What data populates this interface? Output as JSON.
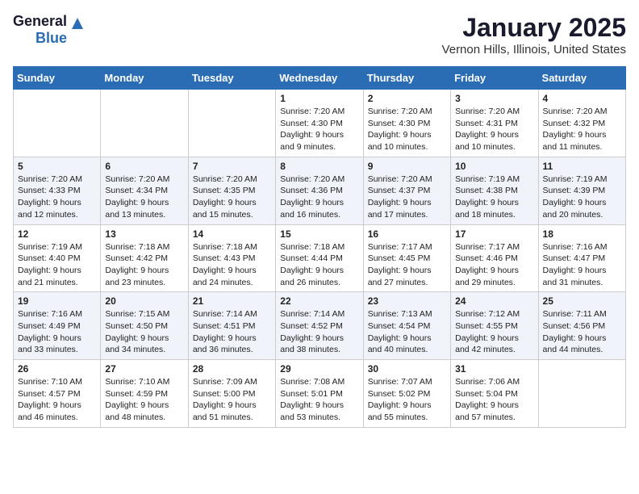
{
  "logo": {
    "general": "General",
    "blue": "Blue"
  },
  "title": "January 2025",
  "subtitle": "Vernon Hills, Illinois, United States",
  "days_of_week": [
    "Sunday",
    "Monday",
    "Tuesday",
    "Wednesday",
    "Thursday",
    "Friday",
    "Saturday"
  ],
  "weeks": [
    [
      {
        "day": "",
        "content": ""
      },
      {
        "day": "",
        "content": ""
      },
      {
        "day": "",
        "content": ""
      },
      {
        "day": "1",
        "content": "Sunrise: 7:20 AM\nSunset: 4:30 PM\nDaylight: 9 hours and 9 minutes."
      },
      {
        "day": "2",
        "content": "Sunrise: 7:20 AM\nSunset: 4:30 PM\nDaylight: 9 hours and 10 minutes."
      },
      {
        "day": "3",
        "content": "Sunrise: 7:20 AM\nSunset: 4:31 PM\nDaylight: 9 hours and 10 minutes."
      },
      {
        "day": "4",
        "content": "Sunrise: 7:20 AM\nSunset: 4:32 PM\nDaylight: 9 hours and 11 minutes."
      }
    ],
    [
      {
        "day": "5",
        "content": "Sunrise: 7:20 AM\nSunset: 4:33 PM\nDaylight: 9 hours and 12 minutes."
      },
      {
        "day": "6",
        "content": "Sunrise: 7:20 AM\nSunset: 4:34 PM\nDaylight: 9 hours and 13 minutes."
      },
      {
        "day": "7",
        "content": "Sunrise: 7:20 AM\nSunset: 4:35 PM\nDaylight: 9 hours and 15 minutes."
      },
      {
        "day": "8",
        "content": "Sunrise: 7:20 AM\nSunset: 4:36 PM\nDaylight: 9 hours and 16 minutes."
      },
      {
        "day": "9",
        "content": "Sunrise: 7:20 AM\nSunset: 4:37 PM\nDaylight: 9 hours and 17 minutes."
      },
      {
        "day": "10",
        "content": "Sunrise: 7:19 AM\nSunset: 4:38 PM\nDaylight: 9 hours and 18 minutes."
      },
      {
        "day": "11",
        "content": "Sunrise: 7:19 AM\nSunset: 4:39 PM\nDaylight: 9 hours and 20 minutes."
      }
    ],
    [
      {
        "day": "12",
        "content": "Sunrise: 7:19 AM\nSunset: 4:40 PM\nDaylight: 9 hours and 21 minutes."
      },
      {
        "day": "13",
        "content": "Sunrise: 7:18 AM\nSunset: 4:42 PM\nDaylight: 9 hours and 23 minutes."
      },
      {
        "day": "14",
        "content": "Sunrise: 7:18 AM\nSunset: 4:43 PM\nDaylight: 9 hours and 24 minutes."
      },
      {
        "day": "15",
        "content": "Sunrise: 7:18 AM\nSunset: 4:44 PM\nDaylight: 9 hours and 26 minutes."
      },
      {
        "day": "16",
        "content": "Sunrise: 7:17 AM\nSunset: 4:45 PM\nDaylight: 9 hours and 27 minutes."
      },
      {
        "day": "17",
        "content": "Sunrise: 7:17 AM\nSunset: 4:46 PM\nDaylight: 9 hours and 29 minutes."
      },
      {
        "day": "18",
        "content": "Sunrise: 7:16 AM\nSunset: 4:47 PM\nDaylight: 9 hours and 31 minutes."
      }
    ],
    [
      {
        "day": "19",
        "content": "Sunrise: 7:16 AM\nSunset: 4:49 PM\nDaylight: 9 hours and 33 minutes."
      },
      {
        "day": "20",
        "content": "Sunrise: 7:15 AM\nSunset: 4:50 PM\nDaylight: 9 hours and 34 minutes."
      },
      {
        "day": "21",
        "content": "Sunrise: 7:14 AM\nSunset: 4:51 PM\nDaylight: 9 hours and 36 minutes."
      },
      {
        "day": "22",
        "content": "Sunrise: 7:14 AM\nSunset: 4:52 PM\nDaylight: 9 hours and 38 minutes."
      },
      {
        "day": "23",
        "content": "Sunrise: 7:13 AM\nSunset: 4:54 PM\nDaylight: 9 hours and 40 minutes."
      },
      {
        "day": "24",
        "content": "Sunrise: 7:12 AM\nSunset: 4:55 PM\nDaylight: 9 hours and 42 minutes."
      },
      {
        "day": "25",
        "content": "Sunrise: 7:11 AM\nSunset: 4:56 PM\nDaylight: 9 hours and 44 minutes."
      }
    ],
    [
      {
        "day": "26",
        "content": "Sunrise: 7:10 AM\nSunset: 4:57 PM\nDaylight: 9 hours and 46 minutes."
      },
      {
        "day": "27",
        "content": "Sunrise: 7:10 AM\nSunset: 4:59 PM\nDaylight: 9 hours and 48 minutes."
      },
      {
        "day": "28",
        "content": "Sunrise: 7:09 AM\nSunset: 5:00 PM\nDaylight: 9 hours and 51 minutes."
      },
      {
        "day": "29",
        "content": "Sunrise: 7:08 AM\nSunset: 5:01 PM\nDaylight: 9 hours and 53 minutes."
      },
      {
        "day": "30",
        "content": "Sunrise: 7:07 AM\nSunset: 5:02 PM\nDaylight: 9 hours and 55 minutes."
      },
      {
        "day": "31",
        "content": "Sunrise: 7:06 AM\nSunset: 5:04 PM\nDaylight: 9 hours and 57 minutes."
      },
      {
        "day": "",
        "content": ""
      }
    ]
  ]
}
